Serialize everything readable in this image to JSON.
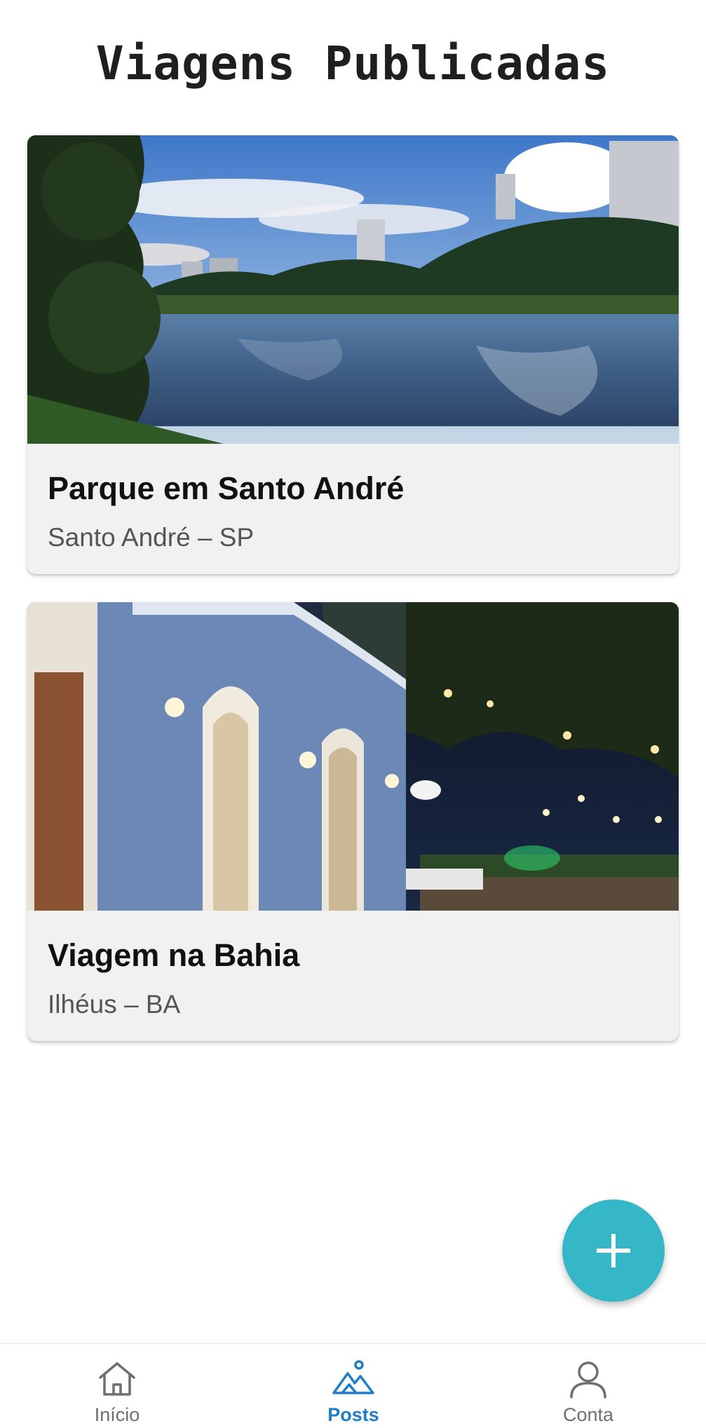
{
  "header": {
    "title": "Viagens Publicadas"
  },
  "posts": [
    {
      "title": "Parque em Santo André",
      "location": "Santo André – SP",
      "image_icon": "lake-park-photo"
    },
    {
      "title": "Viagem na Bahia",
      "location": "Ilhéus – BA",
      "image_icon": "colonial-house-night-photo"
    }
  ],
  "fab": {
    "icon": "plus-icon",
    "color": "#36b7c8"
  },
  "bottom_nav": {
    "items": [
      {
        "label": "Início",
        "icon": "home-icon",
        "active": false
      },
      {
        "label": "Posts",
        "icon": "mountains-icon",
        "active": true
      },
      {
        "label": "Conta",
        "icon": "user-icon",
        "active": false
      }
    ],
    "active_color": "#1e7ec9",
    "inactive_color": "#6f6f6f"
  }
}
